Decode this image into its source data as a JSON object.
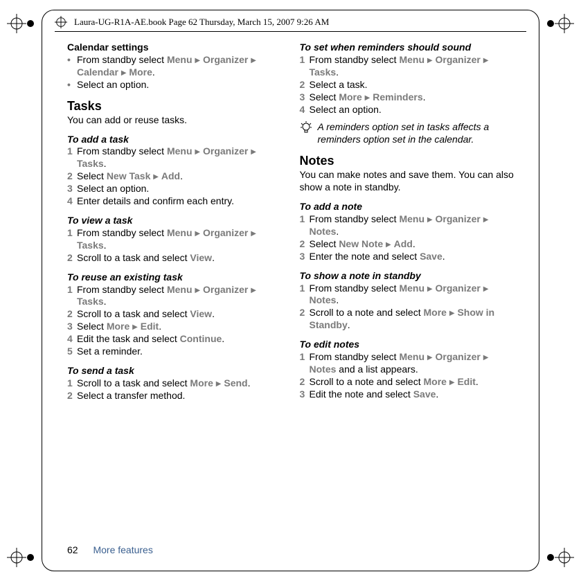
{
  "header": "Laura-UG-R1A-AE.book  Page 62  Thursday, March 15, 2007  9:26 AM",
  "footer": {
    "page": "62",
    "section": "More features"
  },
  "left": {
    "calendar_settings": "Calendar settings",
    "cs_l1a": "From standby select ",
    "cs_l1b": "Menu",
    "cs_l1c": "Organizer",
    "cs_l1d": "Calendar",
    "cs_l1e": "More",
    "cs_l2": "Select an option.",
    "tasks_h": "Tasks",
    "tasks_intro": "You can add or reuse tasks.",
    "to_add_task": "To add a task",
    "at1a": "From standby select ",
    "at1b": "Menu",
    "at1c": "Organizer",
    "at1d": "Tasks",
    "at2a": "Select ",
    "at2b": "New Task",
    "at2c": "Add",
    "at3": "Select an option.",
    "at4": "Enter details and confirm each entry.",
    "to_view_task": "To view a task",
    "vt1a": "From standby select ",
    "vt1b": "Menu",
    "vt1c": "Organizer",
    "vt1d": "Tasks",
    "vt2a": "Scroll to a task and select ",
    "vt2b": "View",
    "to_reuse_task": "To reuse an existing task",
    "rt1a": "From standby select ",
    "rt1b": "Menu",
    "rt1c": "Organizer",
    "rt1d": "Tasks",
    "rt2a": "Scroll to a task and select ",
    "rt2b": "View",
    "rt3a": "Select ",
    "rt3b": "More",
    "rt3c": "Edit",
    "rt4a": "Edit the task and select ",
    "rt4b": "Continue",
    "rt5": "Set a reminder.",
    "to_send_task": "To send a task",
    "st1a": "Scroll to a task and select ",
    "st1b": "More",
    "st1c": "Send",
    "st2": "Select a transfer method."
  },
  "right": {
    "to_set_rem": "To set when reminders should sound",
    "sr1a": "From standby select ",
    "sr1b": "Menu",
    "sr1c": "Organizer",
    "sr1d": "Tasks",
    "sr2": "Select a task.",
    "sr3a": "Select ",
    "sr3b": "More",
    "sr3c": "Reminders",
    "sr4": "Select an option.",
    "tip": "A reminders option set in tasks affects a reminders option set in the calendar.",
    "notes_h": "Notes",
    "notes_intro1": "You can make notes and save them. You can also show a note in standby.",
    "to_add_note": "To add a note",
    "an1a": "From standby select ",
    "an1b": "Menu",
    "an1c": "Organizer",
    "an1d": "Notes",
    "an2a": "Select ",
    "an2b": "New Note",
    "an2c": "Add",
    "an3a": "Enter the note and select ",
    "an3b": "Save",
    "to_show_note": "To show a note in standby",
    "sn1a": "From standby select ",
    "sn1b": "Menu",
    "sn1c": "Organizer",
    "sn1d": "Notes",
    "sn2a": "Scroll to a note and select ",
    "sn2b": "More",
    "sn2c": "Show in Standby",
    "to_edit_notes": "To edit notes",
    "en1a": "From standby select ",
    "en1b": "Menu",
    "en1c": "Organizer",
    "en1d": "Notes",
    "en1e": " and a list appears.",
    "en2a": "Scroll to a note and select ",
    "en2b": "More",
    "en2c": "Edit",
    "en3a": "Edit the note and select ",
    "en3b": "Save"
  }
}
